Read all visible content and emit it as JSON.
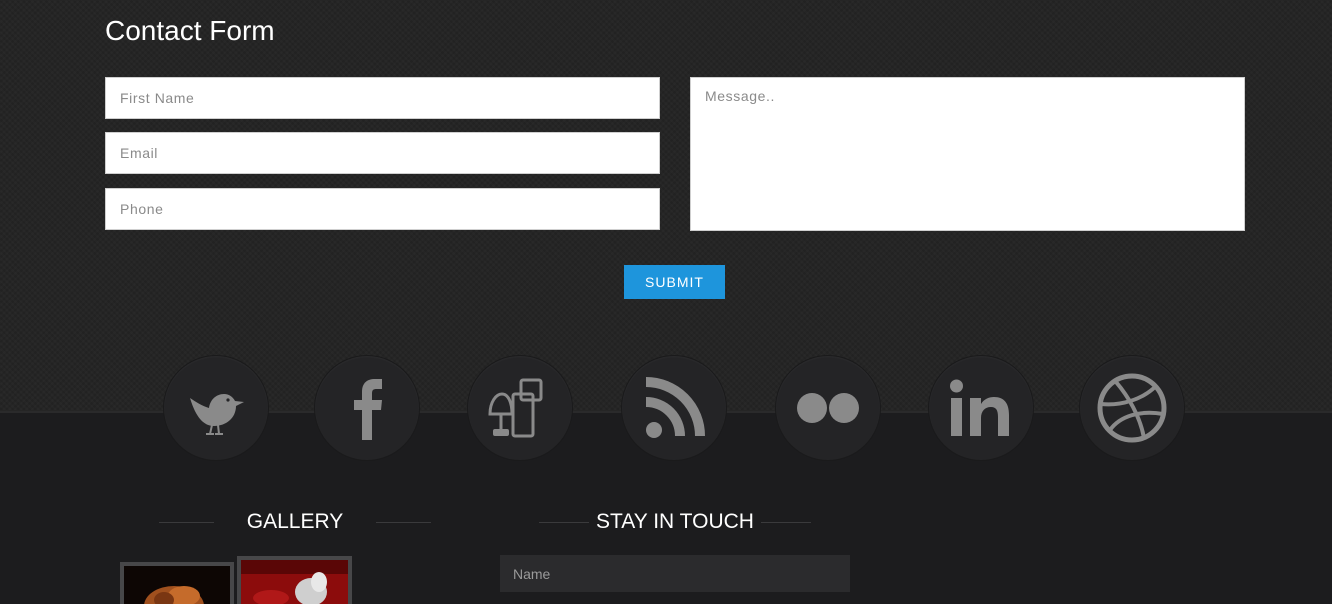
{
  "contact_form": {
    "title": "Contact Form",
    "first_name_placeholder": "First Name",
    "email_placeholder": "Email",
    "phone_placeholder": "Phone",
    "message_placeholder": "Message..",
    "submit_label": "SUBMIT"
  },
  "social_icons": [
    "twitter-bird-icon",
    "facebook-icon",
    "delicious-icon",
    "rss-icon",
    "flickr-icon",
    "linkedin-icon",
    "dribbble-icon"
  ],
  "gallery": {
    "title": "GALLERY"
  },
  "stay_in_touch": {
    "title": "STAY IN TOUCH",
    "name_placeholder": "Name"
  },
  "colors": {
    "accent": "#1e95dc",
    "icon": "#8a8a8a",
    "background": "#1d1d1f"
  }
}
